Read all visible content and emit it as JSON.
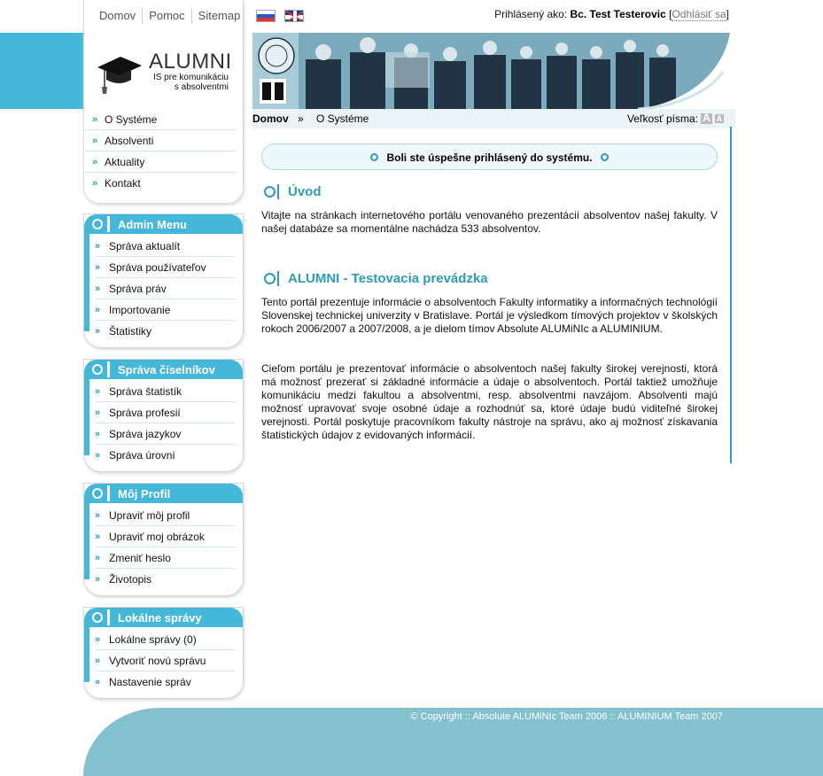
{
  "top_links": [
    "Domov",
    "Pomoc",
    "Sitemap"
  ],
  "login": {
    "prefix": "Prihlásený ako:",
    "user": "Bc. Test Testerovic",
    "logout": "Odhlásiť sa"
  },
  "logo": {
    "title": "ALUMNI",
    "subtitle_line1": "IS pre komunikáciu",
    "subtitle_line2": "s absolventmi"
  },
  "main_nav": [
    "O Systéme",
    "Absolventi",
    "Aktuality",
    "Kontakt"
  ],
  "sidebar": {
    "admin": {
      "title": "Admin Menu",
      "items": [
        "Správa aktualít",
        "Správa používateľov",
        "Správa práv",
        "Importovanie",
        "Štatistiky"
      ]
    },
    "ciselniky": {
      "title": "Správa číselníkov",
      "items": [
        "Správa štatistík",
        "Správa profesií",
        "Správa jazykov",
        "Správa úrovní"
      ]
    },
    "profil": {
      "title": "Môj Profil",
      "items": [
        "Upraviť môj profil",
        "Upraviť moj obrázok",
        "Zmeniť heslo",
        "Životopis"
      ]
    },
    "spravy": {
      "title": "Lokálne správy",
      "items": [
        "Lokálne správy (0)",
        "Vytvoriť novú správu",
        "Nastavenie správ"
      ]
    }
  },
  "breadcrumb": {
    "home": "Domov",
    "sep": "»",
    "current": "O Systéme"
  },
  "font_size": {
    "label": "Veľkosť písma:",
    "big": "A",
    "small": "A"
  },
  "notice": "Boli ste úspešne prihlásený do systému.",
  "sections": [
    {
      "heading": "Úvod",
      "paragraphs": [
        "Vitajte na stránkach internetového portálu venovaného prezentácií absolventov našej fakulty. V našej databáze sa momentálne nachádza 533 absolventov."
      ]
    },
    {
      "heading": "ALUMNI - Testovacia prevádzka",
      "paragraphs": [
        "Tento portál prezentuje informácie o absolventoch Fakulty informatiky a informačných technológií Slovenskej technickej univerzity v Bratislave. Portál je výsledkom tímových projektov v školských rokoch 2006/2007 a 2007/2008, a je dielom tímov Absolute ALUMiNIc a ALUMINIUM.",
        "Cieľom portálu je prezentovať informácie o absolventoch našej fakulty širokej verejnosti, ktorá má možnosť prezerať si základné informácie a údaje o absolventoch. Portál taktiež umožňuje komunikáciu medzi fakultou a absolventmi, resp. absolventmi navzájom. Absolventi majú možnosť upravovať svoje osobné údaje a rozhodnúť sa, ktoré údaje budú viditeľné širokej verejnosti. Portál poskytuje pracovníkom fakulty nástroje na správu, ako aj možnosť získavania štatistických údajov z evidovaných informácií."
      ]
    }
  ],
  "footer": "© Copyright :: Absolute ALUMiNIc Team 2006 :: ALUMINIUM Team 2007",
  "colors": {
    "accent": "#45b7d8",
    "heading": "#2e9bb8",
    "footer": "#84c1cf"
  }
}
